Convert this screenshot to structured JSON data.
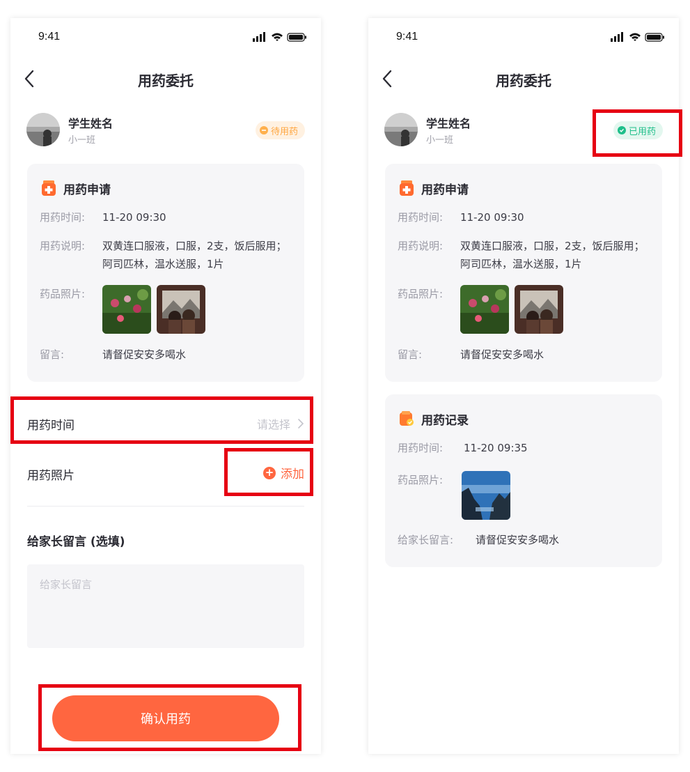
{
  "status_bar": {
    "time": "9:41"
  },
  "nav": {
    "title": "用药委托"
  },
  "student": {
    "name": "学生姓名",
    "class": "小一班"
  },
  "badges": {
    "pending": "待用药",
    "done": "已用药"
  },
  "colors": {
    "accent": "#ff6640",
    "pending": "#ffa640",
    "done": "#1fbf8a",
    "highlight": "#e60012"
  },
  "request_card": {
    "title": "用药申请",
    "rows": [
      {
        "label": "用药时间:",
        "value": "11-20 09:30"
      },
      {
        "label": "用药说明:",
        "value": "双黄连口服液，口服，2支，饭后服用；阿司匹林，温水送服，1片"
      },
      {
        "label": "药品照片:"
      },
      {
        "label": "留言:",
        "value": "请督促安安多喝水"
      }
    ]
  },
  "form": {
    "time_label": "用药时间",
    "time_placeholder": "请选择",
    "photo_label": "用药照片",
    "add_label": "添加",
    "message_title": "给家长留言 (选填)",
    "message_placeholder": "给家长留言",
    "confirm_label": "确认用药"
  },
  "record_card": {
    "title": "用药记录",
    "rows": [
      {
        "label": "用药时间:",
        "value": "11-20 09:35"
      },
      {
        "label": "药品照片:"
      },
      {
        "label": "给家长留言:",
        "value": "请督促安安多喝水"
      }
    ]
  }
}
